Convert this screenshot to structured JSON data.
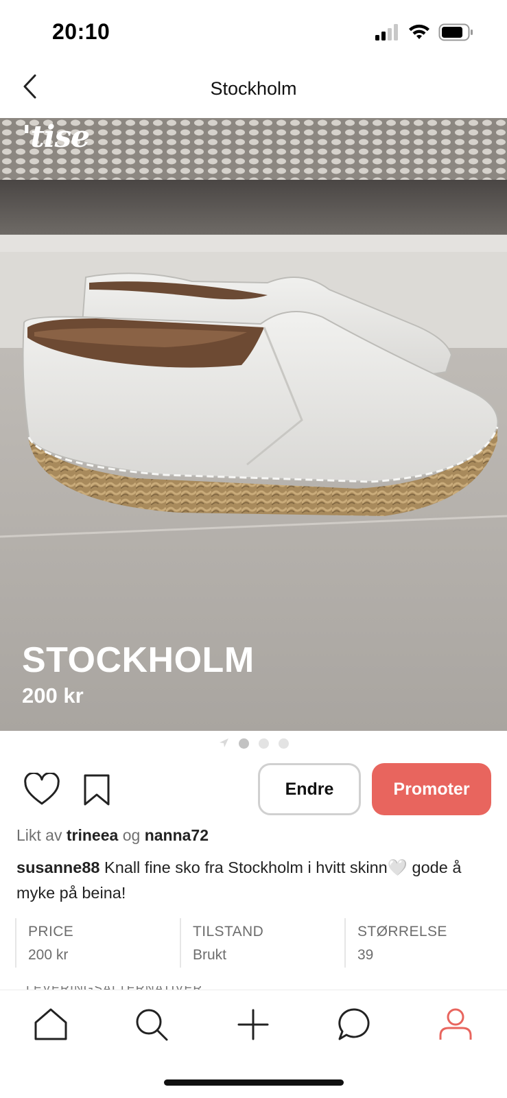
{
  "status_bar": {
    "time": "20:10"
  },
  "header": {
    "title": "Stockholm"
  },
  "hero": {
    "logo": "'tise",
    "title": "STOCKHOLM",
    "price": "200 kr",
    "pager": {
      "count": 3,
      "active_index": 0
    }
  },
  "actions": {
    "edit_label": "Endre",
    "promote_label": "Promoter",
    "promote_color": "#e8655e"
  },
  "liked_by": {
    "prefix": "Likt av",
    "user1": "trineea",
    "conjunction": "og",
    "user2": "nanna72"
  },
  "description": {
    "username": "susanne88",
    "text": "Knall fine sko fra Stockholm i hvitt skinn🤍 gode å myke på beina!"
  },
  "details": [
    {
      "label": "PRICE",
      "value": "200 kr"
    },
    {
      "label": "TILSTAND",
      "value": "Brukt"
    },
    {
      "label": "STØRRELSE",
      "value": "39"
    }
  ],
  "next_section_label": "LEVERINGSALTERNATIVER",
  "bottom_nav": {
    "tabs": [
      "home-icon",
      "search-icon",
      "plus-icon",
      "chat-icon",
      "profile-icon"
    ],
    "active": "profile-icon",
    "active_color": "#e8655e"
  }
}
